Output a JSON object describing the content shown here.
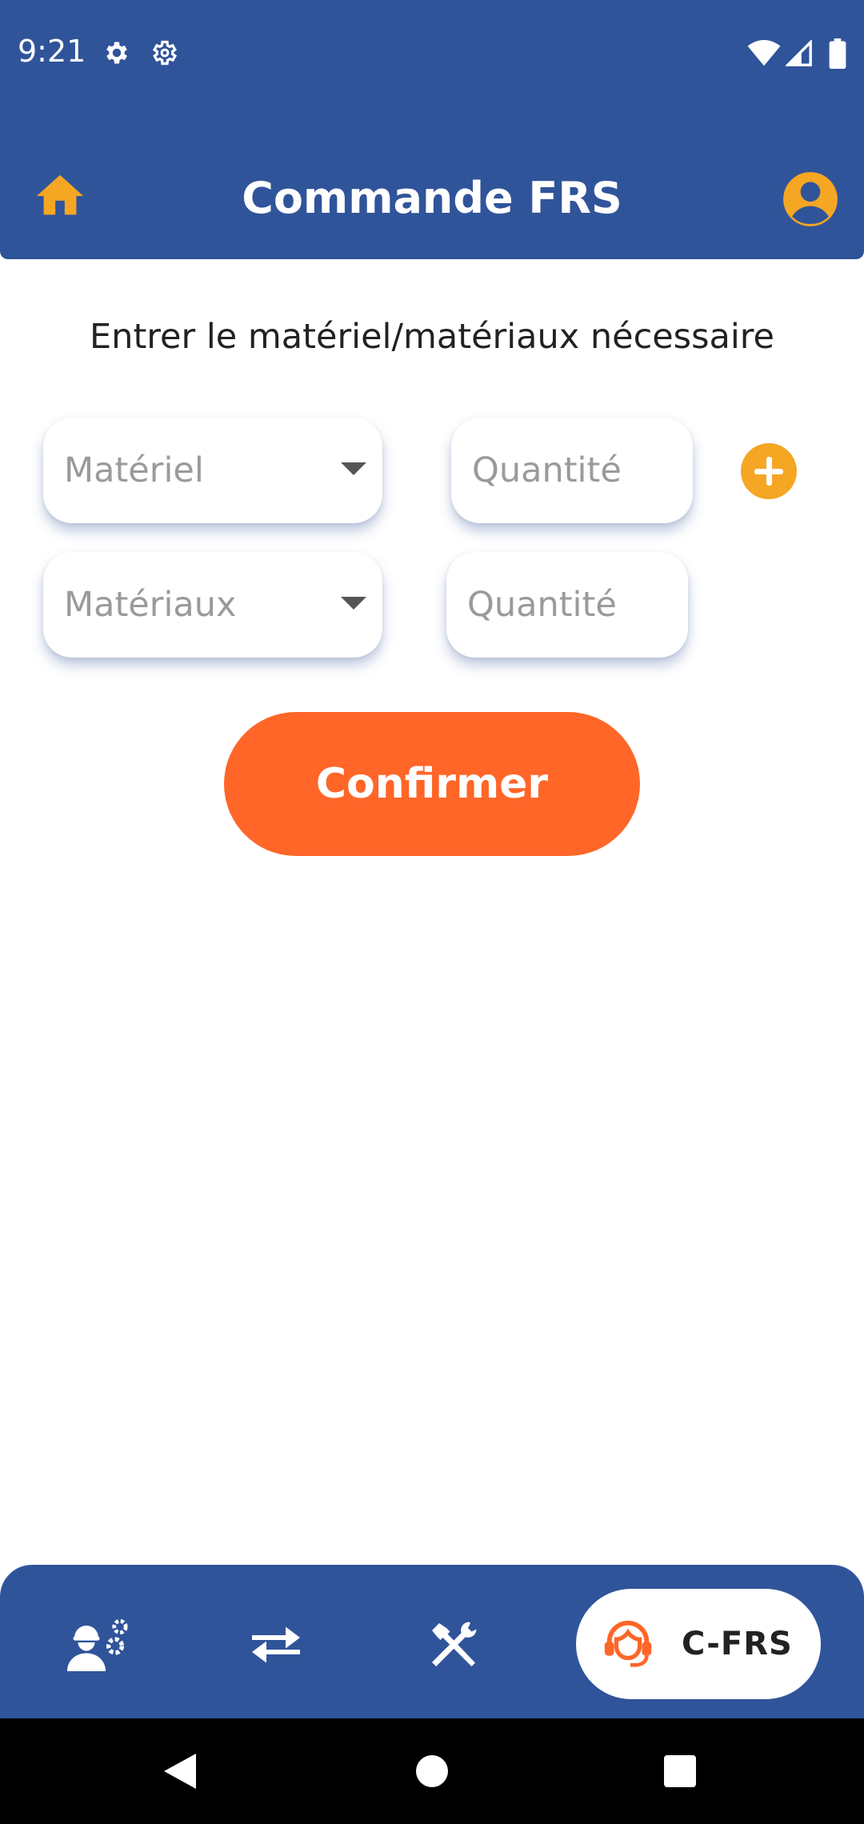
{
  "status_bar": {
    "time": "9:21",
    "icons": [
      "gear-icon",
      "settings-icon",
      "wifi-icon",
      "signal-icon",
      "battery-icon"
    ]
  },
  "header": {
    "title": "Commande FRS",
    "home_icon": "home-icon",
    "profile_icon": "account-circle-icon"
  },
  "form": {
    "instruction": "Entrer le matériel/matériaux nécessaire",
    "rows": [
      {
        "select_placeholder": "Matériel",
        "quantity_placeholder": "Quantité"
      },
      {
        "select_placeholder": "Matériaux",
        "quantity_placeholder": "Quantité"
      }
    ],
    "add_icon": "add-circle-icon",
    "confirm_label": "Confirmer"
  },
  "bottom_nav": {
    "items": [
      {
        "icon": "worker-settings-icon"
      },
      {
        "icon": "swap-arrows-icon"
      },
      {
        "icon": "tools-icon"
      },
      {
        "icon": "support-agent-icon",
        "label": "C-FRS",
        "active": true
      }
    ]
  },
  "colors": {
    "primary": "#30549a",
    "accent": "#f5a623",
    "confirm": "#ff6628",
    "background": "#ffffff"
  }
}
